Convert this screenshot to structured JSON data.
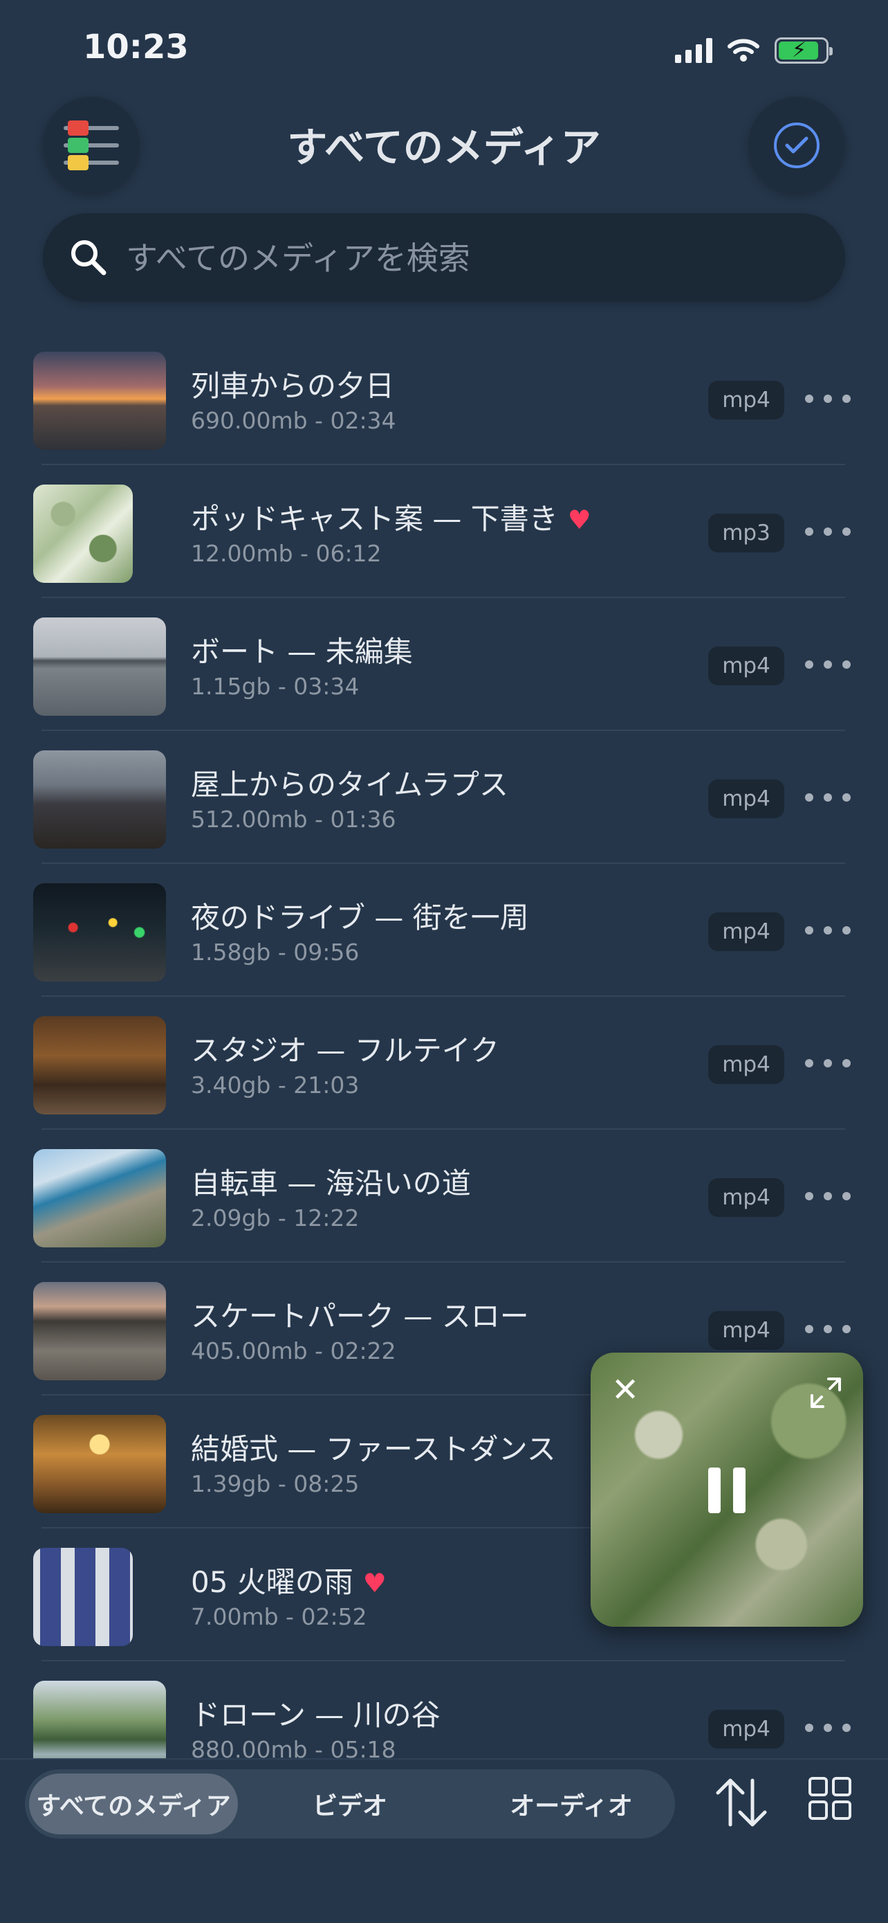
{
  "status_bar": {
    "time": "10:23"
  },
  "header": {
    "title": "すべてのメディア"
  },
  "search": {
    "placeholder": "すべてのメディアを検索"
  },
  "media": [
    {
      "title": "列車からの夕日",
      "meta": "690.00mb - 02:34",
      "format": "mp4",
      "favorite": false,
      "thumb": "sunset-train"
    },
    {
      "title": "ポッドキャスト案 — 下書き",
      "meta": "12.00mb - 06:12",
      "format": "mp3",
      "favorite": true,
      "thumb": "leaves-art"
    },
    {
      "title": "ボート — 未編集",
      "meta": "1.15gb - 03:34",
      "format": "mp4",
      "favorite": false,
      "thumb": "lake"
    },
    {
      "title": "屋上からのタイムラプス",
      "meta": "512.00mb - 01:36",
      "format": "mp4",
      "favorite": false,
      "thumb": "rooftop"
    },
    {
      "title": "夜のドライブ — 街を一周",
      "meta": "1.58gb - 09:56",
      "format": "mp4",
      "favorite": false,
      "thumb": "night-drive"
    },
    {
      "title": "スタジオ — フルテイク",
      "meta": "3.40gb - 21:03",
      "format": "mp4",
      "favorite": false,
      "thumb": "studio"
    },
    {
      "title": "自転車 — 海沿いの道",
      "meta": "2.09gb - 12:22",
      "format": "mp4",
      "favorite": false,
      "thumb": "coast-bike"
    },
    {
      "title": "スケートパーク — スロー",
      "meta": "405.00mb - 02:22",
      "format": "mp4",
      "favorite": false,
      "thumb": "skatepark"
    },
    {
      "title": "結婚式 — ファーストダンス",
      "meta": "1.39gb - 08:25",
      "format": "",
      "favorite": false,
      "thumb": "wedding"
    },
    {
      "title": "05 火曜の雨",
      "meta": "7.00mb - 02:52",
      "format": "",
      "favorite": true,
      "thumb": "rain-art"
    },
    {
      "title": "ドローン — 川の谷",
      "meta": "880.00mb - 05:18",
      "format": "mp4",
      "favorite": false,
      "thumb": "river-valley"
    }
  ],
  "mini_player": {
    "state": "playing"
  },
  "tabs": {
    "all": "すべてのメディア",
    "video": "ビデオ",
    "audio": "オーディオ",
    "active": "all"
  },
  "colors": {
    "accent": "#5b8ef0",
    "favorite": "#ff3b5f",
    "background": "#25364a"
  }
}
